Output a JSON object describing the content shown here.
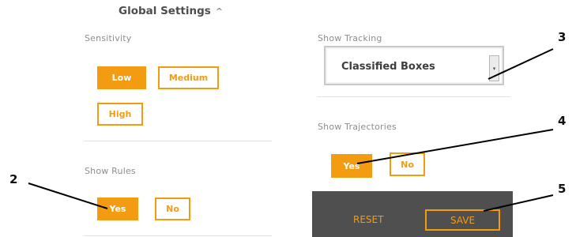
{
  "header": {
    "title": "Global Settings",
    "chevron_icon": "chevron-up-icon",
    "chevron_glyph": "^"
  },
  "sensitivity": {
    "label": "Sensitivity",
    "options": [
      "Low",
      "Medium",
      "High"
    ],
    "selected": "Low"
  },
  "show_rules": {
    "label": "Show Rules",
    "options": [
      "Yes",
      "No"
    ],
    "selected": "Yes"
  },
  "show_tracking": {
    "label": "Show Tracking",
    "value": "Classified Boxes",
    "arrow_icon": "dropdown-arrow-icon",
    "arrow_glyph": "▾"
  },
  "show_trajectories": {
    "label": "Show Trajectories",
    "options": [
      "Yes",
      "No"
    ],
    "selected": "Yes"
  },
  "footer": {
    "reset_label": "RESET",
    "save_label": "SAVE"
  },
  "callouts": [
    "2",
    "3",
    "4",
    "5"
  ],
  "colors": {
    "accent": "#f39c12",
    "footer_bg": "#4f4f4f",
    "label": "#8e8e8e",
    "divider": "#e1e1e1"
  }
}
